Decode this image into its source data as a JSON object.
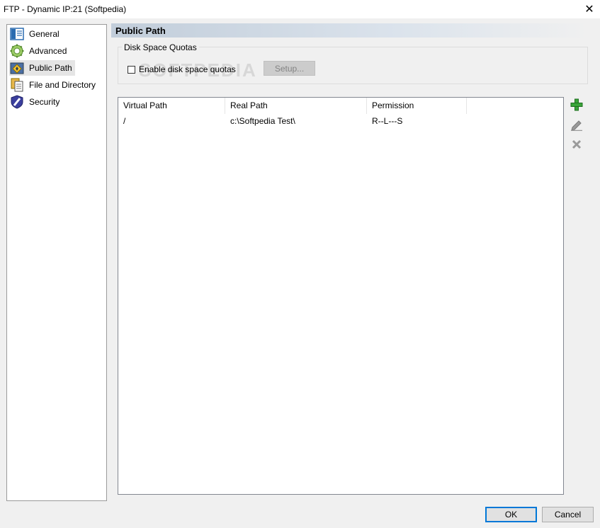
{
  "window": {
    "title": "FTP - Dynamic IP:21 (Softpedia)",
    "close_glyph": "✕"
  },
  "sidebar": {
    "items": [
      {
        "label": "General",
        "icon": "general-icon",
        "selected": false
      },
      {
        "label": "Advanced",
        "icon": "gear-icon",
        "selected": false
      },
      {
        "label": "Public Path",
        "icon": "folder-path-icon",
        "selected": true
      },
      {
        "label": "File and Directory",
        "icon": "files-icon",
        "selected": false
      },
      {
        "label": "Security",
        "icon": "shield-icon",
        "selected": false
      }
    ]
  },
  "main": {
    "header": "Public Path",
    "quotas": {
      "legend": "Disk Space Quotas",
      "checkbox_label": "Enable disk space quotas",
      "checked": false,
      "setup_label": "Setup..."
    },
    "watermark": "SOFTPEDIA",
    "table": {
      "columns": [
        "Virtual Path",
        "Real Path",
        "Permission"
      ],
      "rows": [
        {
          "virtual": "/",
          "real": "c:\\Softpedia Test\\",
          "permission": "R--L---S"
        }
      ]
    }
  },
  "footer": {
    "ok_label": "OK",
    "cancel_label": "Cancel"
  },
  "colors": {
    "add_green": "#3aa53a",
    "selection_gray": "#e5e5e5",
    "ok_border": "#0078d7"
  }
}
